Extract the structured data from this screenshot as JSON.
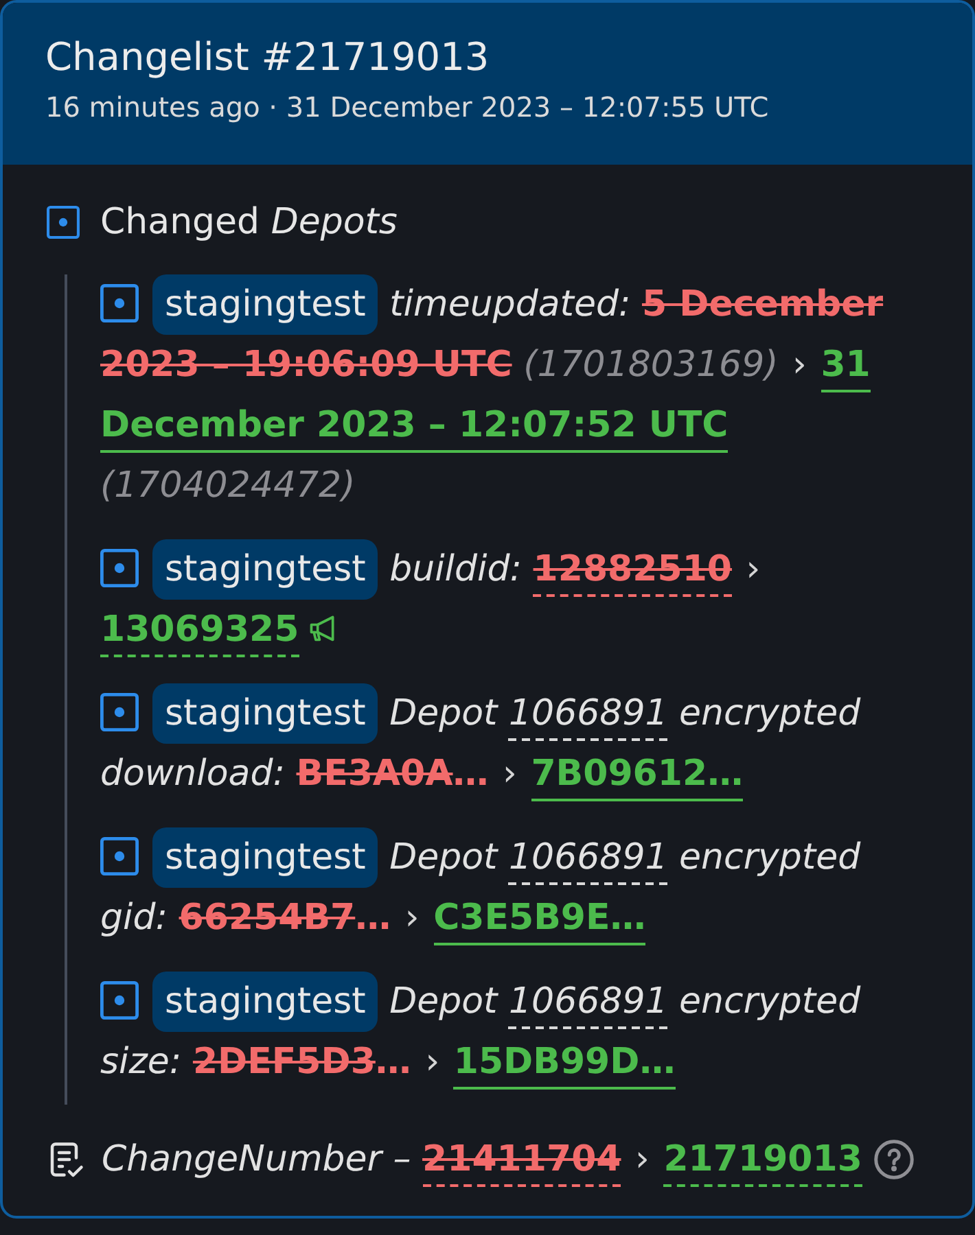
{
  "header": {
    "title": "Changelist #21719013",
    "subtitle": "16 minutes ago · 31 December 2023 – 12:07:55 UTC"
  },
  "section": {
    "title": "Changed *Depots*",
    "changes": [
      {
        "badge": "stagingtest",
        "parts": [
          {
            "kind": "label",
            "text": "timeupdated:"
          },
          {
            "kind": "old",
            "text": "5 December",
            "underlined": false
          },
          {
            "kind": "old",
            "text": "2023 – 19:06:09 UTC",
            "underlined": false
          },
          {
            "kind": "note",
            "text": "(1701803169)"
          },
          {
            "kind": "arrow",
            "text": "›"
          },
          {
            "kind": "new",
            "text": "31",
            "underlined": true,
            "dashed": false,
            "icon": false
          },
          {
            "kind": "new",
            "text": "December 2023 – 12:07:52 UTC",
            "underlined": true,
            "dashed": false,
            "icon": false
          },
          {
            "kind": "note",
            "text": "(1704024472)"
          }
        ]
      },
      {
        "badge": "stagingtest",
        "parts": [
          {
            "kind": "label",
            "text": "buildid:"
          },
          {
            "kind": "old",
            "text": "12882510",
            "underlined": true,
            "dashed": true
          },
          {
            "kind": "arrow",
            "text": "›"
          },
          {
            "kind": "new",
            "text": "13069325",
            "underlined": true,
            "dashed": true,
            "icon": true
          }
        ]
      },
      {
        "badge": "stagingtest",
        "parts": [
          {
            "kind": "label",
            "text": "Depot"
          },
          {
            "kind": "link",
            "text": "1066891"
          },
          {
            "kind": "label",
            "text": "encrypted"
          },
          {
            "kind": "label",
            "text": "download:"
          },
          {
            "kind": "old",
            "text": "BE3A0A",
            "truncation": "…",
            "underlined": false
          },
          {
            "kind": "arrow",
            "text": "›"
          },
          {
            "kind": "new",
            "text": "7B09612…",
            "underlined": true,
            "dashed": false,
            "icon": false
          }
        ]
      },
      {
        "badge": "stagingtest",
        "parts": [
          {
            "kind": "label",
            "text": "Depot"
          },
          {
            "kind": "link",
            "text": "1066891"
          },
          {
            "kind": "label",
            "text": "encrypted"
          },
          {
            "kind": "label",
            "text": "gid:"
          },
          {
            "kind": "old",
            "text": "66254B7",
            "truncation": "…",
            "underlined": false
          },
          {
            "kind": "arrow",
            "text": "›"
          },
          {
            "kind": "new",
            "text": "C3E5B9E…",
            "underlined": true,
            "dashed": false,
            "icon": false
          }
        ]
      },
      {
        "badge": "stagingtest",
        "parts": [
          {
            "kind": "label",
            "text": "Depot"
          },
          {
            "kind": "link",
            "text": "1066891"
          },
          {
            "kind": "label",
            "text": "encrypted"
          },
          {
            "kind": "label",
            "text": "size:"
          },
          {
            "kind": "old",
            "text": "2DEF5D3",
            "truncation": "…",
            "underlined": false
          },
          {
            "kind": "arrow",
            "text": "›"
          },
          {
            "kind": "new",
            "text": "15DB99D…",
            "underlined": true,
            "dashed": false,
            "icon": false
          }
        ]
      }
    ]
  },
  "footer": {
    "label": "ChangeNumber –",
    "old": {
      "text": "21411704",
      "underlined": true,
      "dashed": true
    },
    "arrow": "›",
    "new": {
      "text": "21719013",
      "underlined": true,
      "dashed": true
    }
  }
}
